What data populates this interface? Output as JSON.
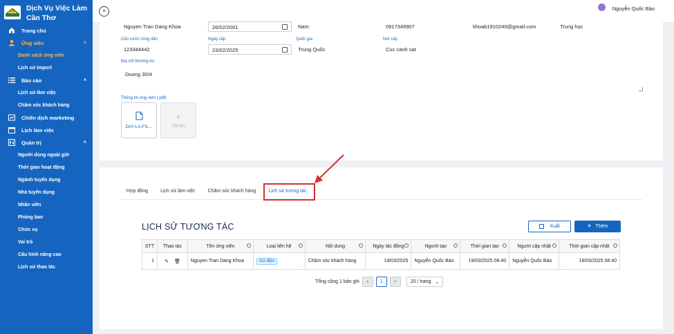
{
  "sidebar": {
    "brand_line1": "Dịch Vụ Việc Làm",
    "brand_line2": "Cần Thơ",
    "items": [
      {
        "label": "Trang chủ",
        "icon": "home-icon"
      },
      {
        "label": "Ứng viên",
        "icon": "user-icon"
      },
      {
        "label": "Danh sách ứng viên"
      },
      {
        "label": "Lịch sử import"
      },
      {
        "label": "Báo cáo",
        "icon": "list-icon"
      },
      {
        "label": "Lịch sử làm việc"
      },
      {
        "label": "Chăm sóc khách hàng"
      },
      {
        "label": "Chiến dịch marketing",
        "icon": "campaign-icon"
      },
      {
        "label": "Lịch làm việc",
        "icon": "calendar-icon"
      },
      {
        "label": "Quản trị",
        "icon": "settings-icon"
      },
      {
        "label": "Người dùng ngoài giờ"
      },
      {
        "label": "Thời gian hoạt động"
      },
      {
        "label": "Ngành tuyển dụng"
      },
      {
        "label": "Nhà tuyển dụng"
      },
      {
        "label": "Nhân viên"
      },
      {
        "label": "Phòng ban"
      },
      {
        "label": "Chức vụ"
      },
      {
        "label": "Vai trò"
      },
      {
        "label": "Cấu hình nâng cao"
      },
      {
        "label": "Lịch sử thao tác"
      }
    ]
  },
  "topbar": {
    "user_name": "Nguyễn Quốc Bảo"
  },
  "candidate": {
    "name": "Nguyen Tran Dang Khoa",
    "dob": "26/02/2001",
    "gender": "Nam",
    "phone": "0917349907",
    "email": "khoab1910240@gmail.com",
    "education": "Trung học",
    "id_label": "Căn cước công dân",
    "id_value": "123344442",
    "issue_date_label": "Ngày cấp",
    "issue_date": "23/02/2025",
    "nationality_label": "Quốc gia",
    "nationality": "Trung Quốc",
    "issue_place_label": "Nơi cấp",
    "issue_place": "Cuc canh sat",
    "address_label": "Địa chỉ thường trú",
    "address": "Duong 30/4",
    "attachments_label": "Thông tin ứng viên (.pdf)",
    "file_name": "DAY-LA-FIL...",
    "upload_label": "Tải lên"
  },
  "tabs": [
    "Hợp đồng",
    "Lịch sử làm việc",
    "Chăm sóc khách hàng",
    "Lịch sử tương tác"
  ],
  "history": {
    "title": "LỊCH SỬ TƯƠNG TÁC",
    "export_label": "Xuất",
    "add_label": "Thêm",
    "columns": [
      "STT",
      "Thao tác",
      "Tên ứng viên",
      "Loại liên hệ",
      "Nội dung",
      "Ngày tác động",
      "Người tạo",
      "Thời gian tạo",
      "Người cập nhật",
      "Thời gian cập nhật"
    ],
    "rows": [
      {
        "stt": "1",
        "candidate": "Nguyen Tran Dang Khoa",
        "contact_type": "Gọi điện",
        "content": "Chăm sóc khách hàng",
        "action_date": "19/03/2025",
        "creator": "Nguyễn Quốc Bảo",
        "created_at": "19/03/2025 08:40",
        "updater": "Nguyễn Quốc Bảo",
        "updated_at": "19/03/2025 08:40"
      }
    ],
    "total_text": "Tổng cộng 1 bản ghi",
    "current_page": "1",
    "page_size": "20 / trang"
  }
}
